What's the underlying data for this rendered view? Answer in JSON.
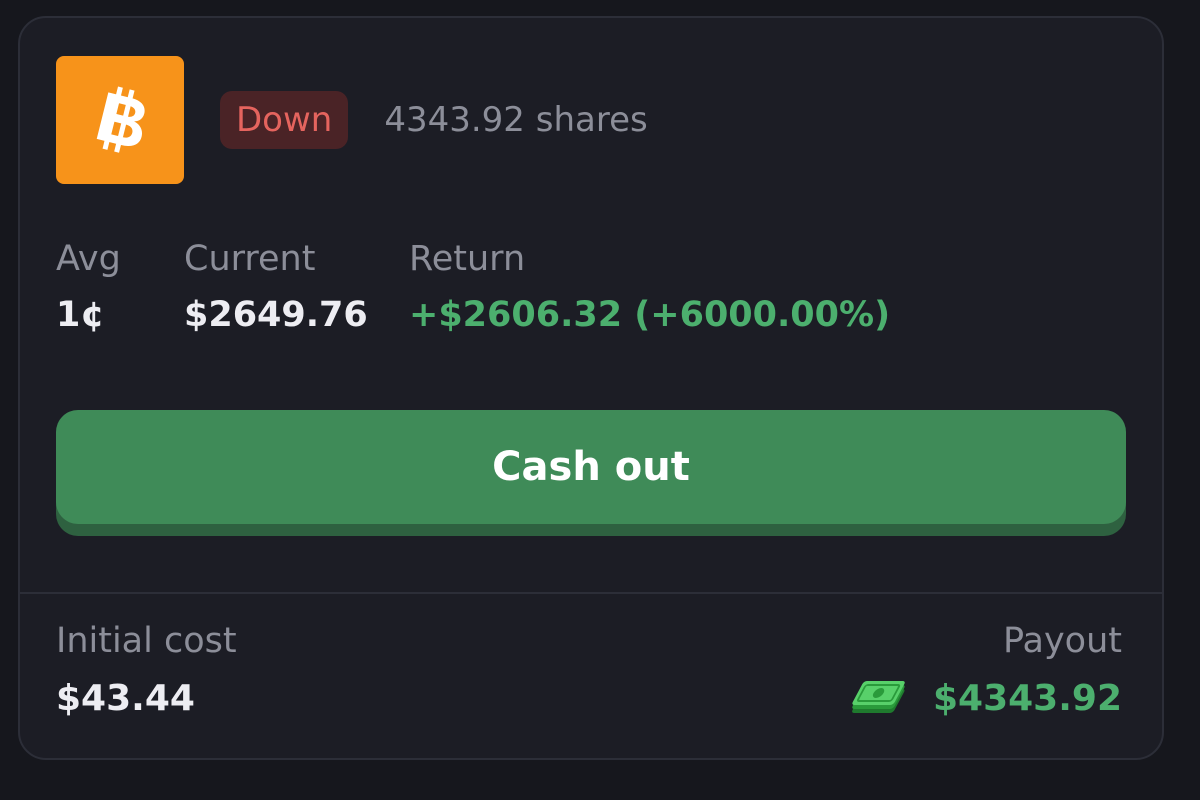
{
  "colors": {
    "coin_bg": "#f7931a",
    "badge_bg": "#4a2326",
    "badge_text": "#e5645e",
    "positive": "#4caf6e",
    "button_bg": "#3f8b58"
  },
  "position": {
    "coin_icon": "bitcoin-icon",
    "direction_badge": "Down",
    "shares": "4343.92 shares"
  },
  "stats": {
    "avg": {
      "label": "Avg",
      "value": "1¢"
    },
    "current": {
      "label": "Current",
      "value": "$2649.76"
    },
    "return": {
      "label": "Return",
      "value": "+$2606.32 (+6000.00%)"
    }
  },
  "actions": {
    "cashout_label": "Cash out"
  },
  "footer": {
    "initial_cost": {
      "label": "Initial cost",
      "value": "$43.44"
    },
    "payout": {
      "label": "Payout",
      "value": "$4343.92",
      "icon": "money-icon"
    }
  }
}
